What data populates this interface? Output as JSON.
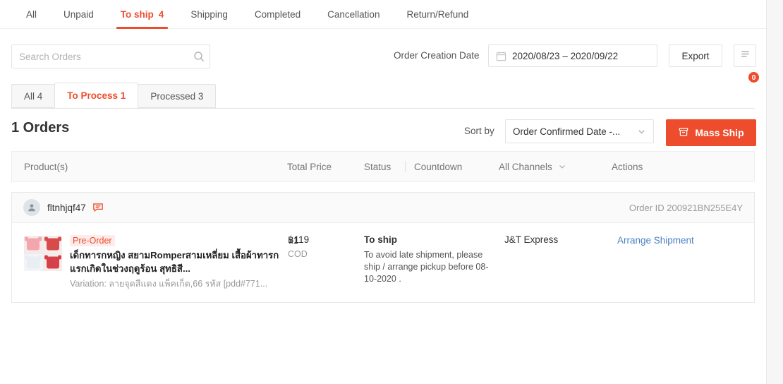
{
  "topnav": {
    "items": [
      {
        "label": "All",
        "count": "",
        "active": false
      },
      {
        "label": "Unpaid",
        "count": "",
        "active": false
      },
      {
        "label": "To ship",
        "count": "4",
        "active": true
      },
      {
        "label": "Shipping",
        "count": "",
        "active": false
      },
      {
        "label": "Completed",
        "count": "",
        "active": false
      },
      {
        "label": "Cancellation",
        "count": "",
        "active": false
      },
      {
        "label": "Return/Refund",
        "count": "",
        "active": false
      }
    ]
  },
  "filters": {
    "search_placeholder": "Search Orders",
    "search_value": "",
    "search_icon": "search-icon",
    "creation_date_label": "Order Creation Date",
    "date_range": "2020/08/23 – 2020/09/22",
    "calendar_icon": "calendar-icon",
    "export_label": "Export",
    "list_icon": "document-list-icon",
    "list_badge": "0"
  },
  "subtabs": [
    {
      "label": "All 4",
      "active": false
    },
    {
      "label": "To Process 1",
      "active": true
    },
    {
      "label": "Processed 3",
      "active": false
    }
  ],
  "orders_header": {
    "title": "1 Orders",
    "sort_label": "Sort by",
    "sort_value": "Order Confirmed Date -...",
    "chevron_icon": "chevron-down-icon",
    "mass_ship_label": "Mass Ship",
    "mass_ship_icon": "box-icon"
  },
  "table": {
    "columns": {
      "product": "Product(s)",
      "total_price": "Total Price",
      "status": "Status",
      "countdown": "Countdown",
      "channels": "All Channels",
      "channels_icon": "chevron-down-icon",
      "actions": "Actions"
    }
  },
  "order": {
    "avatar_icon": "user-avatar-icon",
    "username": "fltnhjqf47",
    "chat_icon": "chat-icon",
    "order_id": "Order ID 200921BN255E4Y",
    "product": {
      "badge": "Pre-Order",
      "name": "เด็กทารกหญิง สยามRomperสามเหลี่ยม เสื้อผ้าทารกแรกเกิดในช่วงฤดูร้อน สุทธิสี...",
      "variation": "Variation: ลายจุดสีแดง แพ็คเก็ต,66 รหัส [pdd#771...",
      "quantity": "x1"
    },
    "price": "฿119",
    "payment_type": "COD",
    "status": "To ship",
    "status_note": "To avoid late shipment, please ship / arrange pickup before 08-10-2020 .",
    "channel": "J&T Express",
    "action": "Arrange Shipment"
  },
  "colors": {
    "accent": "#ee4d2d",
    "link": "#4a80c4",
    "badge": "#ee4d2d"
  }
}
